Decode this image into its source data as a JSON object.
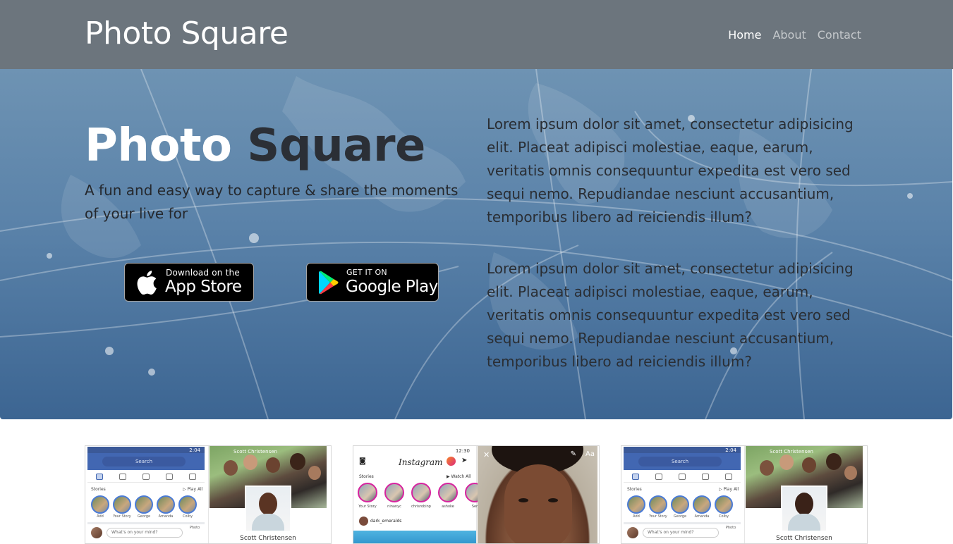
{
  "navbar": {
    "brand": "Photo Square",
    "links": [
      {
        "label": "Home",
        "active": true
      },
      {
        "label": "About",
        "active": false
      },
      {
        "label": "Contact",
        "active": false
      }
    ]
  },
  "hero": {
    "title_word1": "Photo",
    "title_word2": "Square",
    "tagline": "A fun and easy way to capture & share the moments of your live for",
    "paragraphs": [
      "Lorem ipsum dolor sit amet, consectetur adipisicing elit. Placeat adipisci molestiae, eaque, earum, veritatis omnis consequuntur expedita est vero sed sequi nemo. Repudiandae nesciunt accusantium, temporibus libero ad reiciendis illum?",
      "Lorem ipsum dolor sit amet, consectetur adipisicing elit. Placeat adipisci molestiae, eaque, earum, veritatis omnis consequuntur expedita est vero sed sequi nemo. Repudiandae nesciunt accusantium, temporibus libero ad reiciendis illum?"
    ],
    "app_store": {
      "small": "Download on the",
      "big": "App Store",
      "icon": "apple-icon"
    },
    "google_play": {
      "small": "GET IT ON",
      "big": "Google Play",
      "icon": "google-play-icon"
    }
  },
  "screenshots": {
    "facebook": {
      "time": "2:04",
      "search": "Search",
      "stories_label": "Stories",
      "play_all": "▷ Play All",
      "story_names": [
        "Add",
        "Your Story",
        "George",
        "Amanda",
        "Colby"
      ],
      "mind": "What's on your mind?",
      "photo": "Photo",
      "profile_name": "Scott Christensen",
      "top_name": "Scott Christensen"
    },
    "instagram": {
      "time": "12:30",
      "logo": "Instagram",
      "stories_label": "Stories",
      "watch_all": "▶ Watch All",
      "story_names": [
        "Your Story",
        "ninanyc",
        "chrisrobinp",
        "ashoke",
        "Ser"
      ],
      "post_user": "dark_emeralds",
      "close": "✕",
      "aa": "Aa",
      "pen": "✎"
    }
  },
  "colors": {
    "navbar": "#6c757d",
    "hero_top": "#6e93b3",
    "hero_bottom": "#3c6592"
  }
}
